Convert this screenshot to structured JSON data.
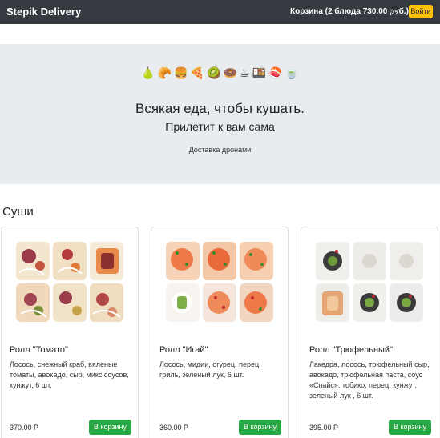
{
  "navbar": {
    "brand": "Stepik Delivery",
    "cart_text": "Корзина (2 блюда 730.00 руб.)",
    "cart_emoji": "😍",
    "login_label": "Войти"
  },
  "hero": {
    "emojis": [
      "🍐",
      "🥐",
      "🍔",
      "🍕",
      "🥝",
      "🍩",
      "☕",
      "🍱",
      "🍣",
      "🍵"
    ],
    "title": "Всякая еда, чтобы кушать.",
    "subtitle": "Прилетит к вам сама",
    "tagline": "Доставка дронами"
  },
  "section": {
    "title": "Суши"
  },
  "products": [
    {
      "title": "Ролл \"Томато\"",
      "description": "Лосось, снежный краб, вяленые томаты, авокадо, сыр, микс соусов, кунжут, 6 шт.",
      "price": "370.00 Р",
      "button": "В корзину"
    },
    {
      "title": "Ролл \"Игай\"",
      "description": "Лосось, мидии, огурец, перец гриль, зеленый лук, 6 шт.",
      "price": "360.00 Р",
      "button": "В корзину"
    },
    {
      "title": "Ролл \"Трюфельный\"",
      "description": "Лакедра, лосось, трюфельный сыр, авокадо, трюфельная паста, соус «Спайс», тобико, перец, кунжут, зеленый лук , 6 шт.",
      "price": "395.00 Р",
      "button": "В корзину"
    }
  ],
  "colors": {
    "navbar_bg": "#343a40",
    "login_btn": "#ffc107",
    "cart_btn": "#28a745",
    "jumbotron_bg": "#e9ecef"
  }
}
